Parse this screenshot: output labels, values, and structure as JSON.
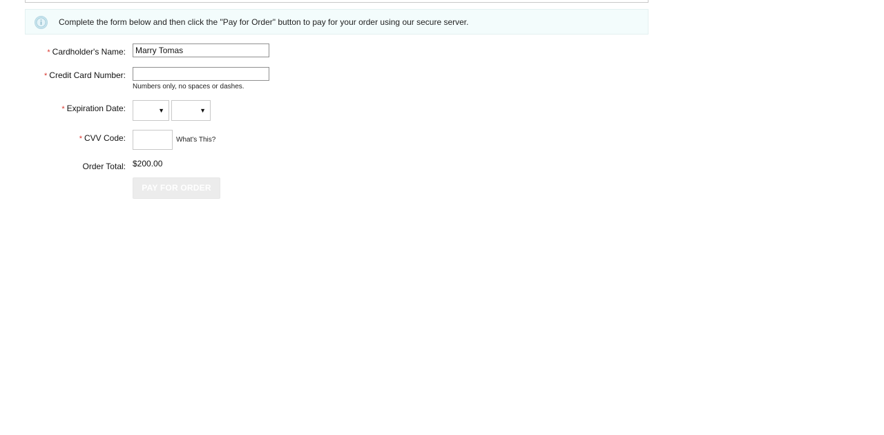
{
  "info": {
    "message": "Complete the form below and then click the \"Pay for Order\" button to pay for your order using our secure server.",
    "icon": "info-icon"
  },
  "form": {
    "required_marker": "*",
    "cardholder": {
      "label": "Cardholder's Name:",
      "value": "Marry Tomas"
    },
    "card_number": {
      "label": "Credit Card Number:",
      "value": "",
      "hint": "Numbers only, no spaces or dashes."
    },
    "expiration": {
      "label": "Expiration Date:",
      "month_value": "",
      "year_value": "",
      "arrow": "▼"
    },
    "cvv": {
      "label": "CVV Code:",
      "value": "",
      "help_link": "What's This?"
    },
    "order_total": {
      "label": "Order Total:",
      "value": "$200.00"
    },
    "pay_button": {
      "label": "PAY FOR ORDER"
    }
  },
  "colors": {
    "info_background": "#f3fcfc",
    "required_marker": "#d9342b",
    "button_disabled_bg": "#ececec"
  }
}
